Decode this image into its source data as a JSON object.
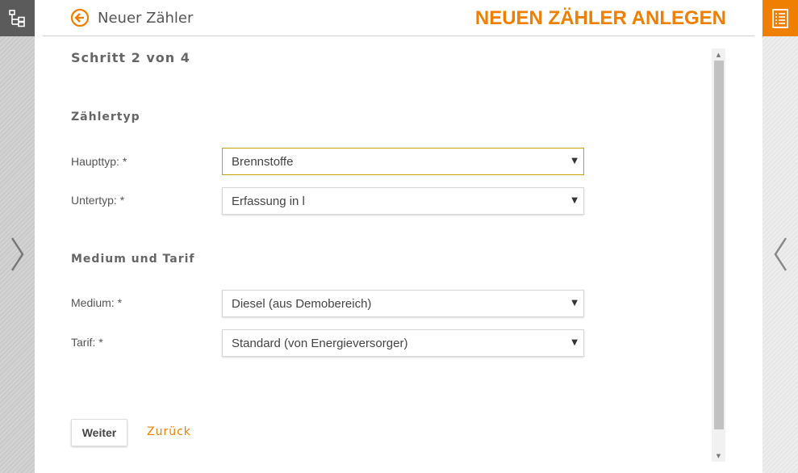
{
  "header": {
    "back_label": "Neuer Zähler",
    "title": "NEUEN ZÄHLER ANLEGEN"
  },
  "step": "Schritt 2 von 4",
  "sections": {
    "meter_type": {
      "title": "Zählertyp",
      "main_type": {
        "label": "Haupttyp: *",
        "value": "Brennstoffe"
      },
      "sub_type": {
        "label": "Untertyp: *",
        "value": "Erfassung in l"
      }
    },
    "medium_tariff": {
      "title": "Medium und Tarif",
      "medium": {
        "label": "Medium: *",
        "value": "Diesel (aus Demobereich)"
      },
      "tariff": {
        "label": "Tarif: *",
        "value": "Standard (von Energieversorger)"
      }
    }
  },
  "buttons": {
    "next": "Weiter",
    "back": "Zurück"
  },
  "icons": {
    "tree": "tree-structure-icon",
    "document": "document-list-icon",
    "back": "arrow-left-circle-icon",
    "left_nav": "chevron-right-icon",
    "right_nav": "chevron-left-icon"
  },
  "colors": {
    "accent": "#ee7f00",
    "focus_border": "#c9a200",
    "dark_button": "#5b5b5b"
  }
}
